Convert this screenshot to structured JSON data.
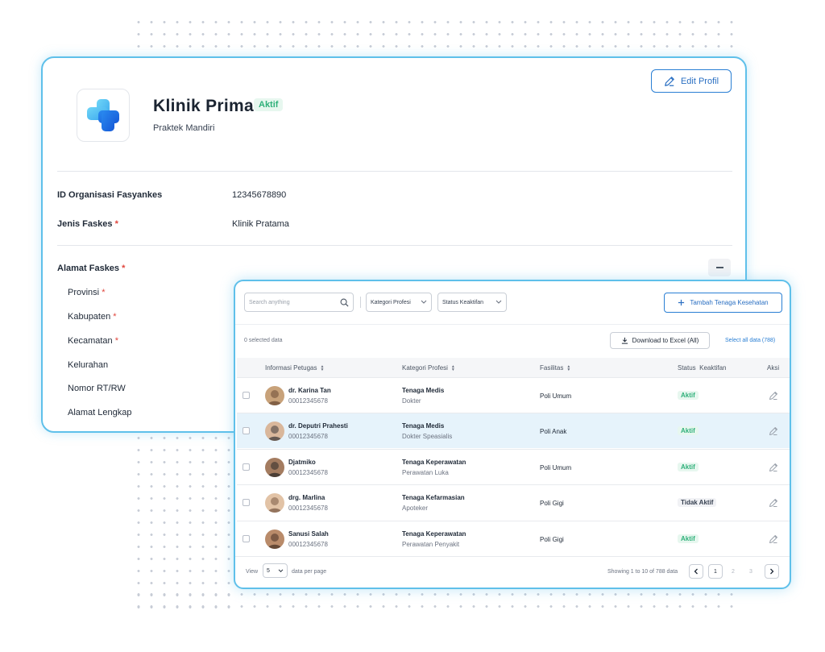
{
  "profile": {
    "clinic_name": "Klinik Prima",
    "status": "Aktif",
    "clinic_type": "Praktek Mandiri",
    "edit_label": "Edit Profil",
    "fields": [
      {
        "label": "ID Organisasi Fasyankes",
        "value": "12345678890",
        "required": false
      },
      {
        "label": "Jenis Faskes",
        "value": "Klinik Pratama",
        "required": true
      }
    ],
    "address_label": "Alamat Faskes",
    "address_fields": [
      {
        "label": "Provinsi",
        "required": true
      },
      {
        "label": "Kabupaten",
        "required": true
      },
      {
        "label": "Kecamatan",
        "required": true
      },
      {
        "label": "Kelurahan",
        "required": false
      },
      {
        "label": "Nomor RT/RW",
        "required": false
      },
      {
        "label": "Alamat Lengkap",
        "required": false
      }
    ],
    "required_mark": "*"
  },
  "table_panel": {
    "search_placeholder": "Search anything",
    "filters": [
      "Kategori Profesi",
      "Status Keaktifan"
    ],
    "add_label": "Tambah Tenaga Kesehatan",
    "selected_text": "0 selected data",
    "download_label": "Download to Excel (All)",
    "select_all_label": "Select all data (788)",
    "columns": [
      "Informasi Petugas",
      "Kategori Profesi",
      "Fasilitas",
      "Status  Keaktifan",
      "Aksi"
    ],
    "rows": [
      {
        "name": "dr. Karina Tan",
        "id": "00012345678",
        "category": "Tenaga Medis",
        "subcategory": "Dokter",
        "facility": "Poli Umum",
        "status": "Aktif",
        "highlighted": false
      },
      {
        "name": "dr. Deputri Prahesti",
        "id": "00012345678",
        "category": "Tenaga Medis",
        "subcategory": "Dokter Speasialis",
        "facility": "Poli Anak",
        "status": "Aktif",
        "highlighted": true
      },
      {
        "name": "Djatmiko",
        "id": "00012345678",
        "category": "Tenaga Keperawatan",
        "subcategory": "Perawatan Luka",
        "facility": "Poli Umum",
        "status": "Aktif",
        "highlighted": false
      },
      {
        "name": "drg. Marlina",
        "id": "00012345678",
        "category": "Tenaga Kefarmasian",
        "subcategory": "Apoteker",
        "facility": "Poli Gigi",
        "status": "Tidak Aktif",
        "highlighted": false
      },
      {
        "name": "Sanusi Salah",
        "id": "00012345678",
        "category": "Tenaga Keperawatan",
        "subcategory": "Perawatan Penyakit",
        "facility": "Poli Gigi",
        "status": "Aktif",
        "highlighted": false
      }
    ],
    "footer": {
      "view_label": "View",
      "per_page_value": "5",
      "per_page_label": "data per page",
      "showing_text": "Showing 1 to 10 of 788 data",
      "pages": [
        "1",
        "2",
        "3"
      ]
    }
  },
  "colors": {
    "accent": "#2a7fd4",
    "border_glow": "#5fc0ea",
    "active_green": "#2fb07a",
    "required_red": "#e0463d"
  }
}
